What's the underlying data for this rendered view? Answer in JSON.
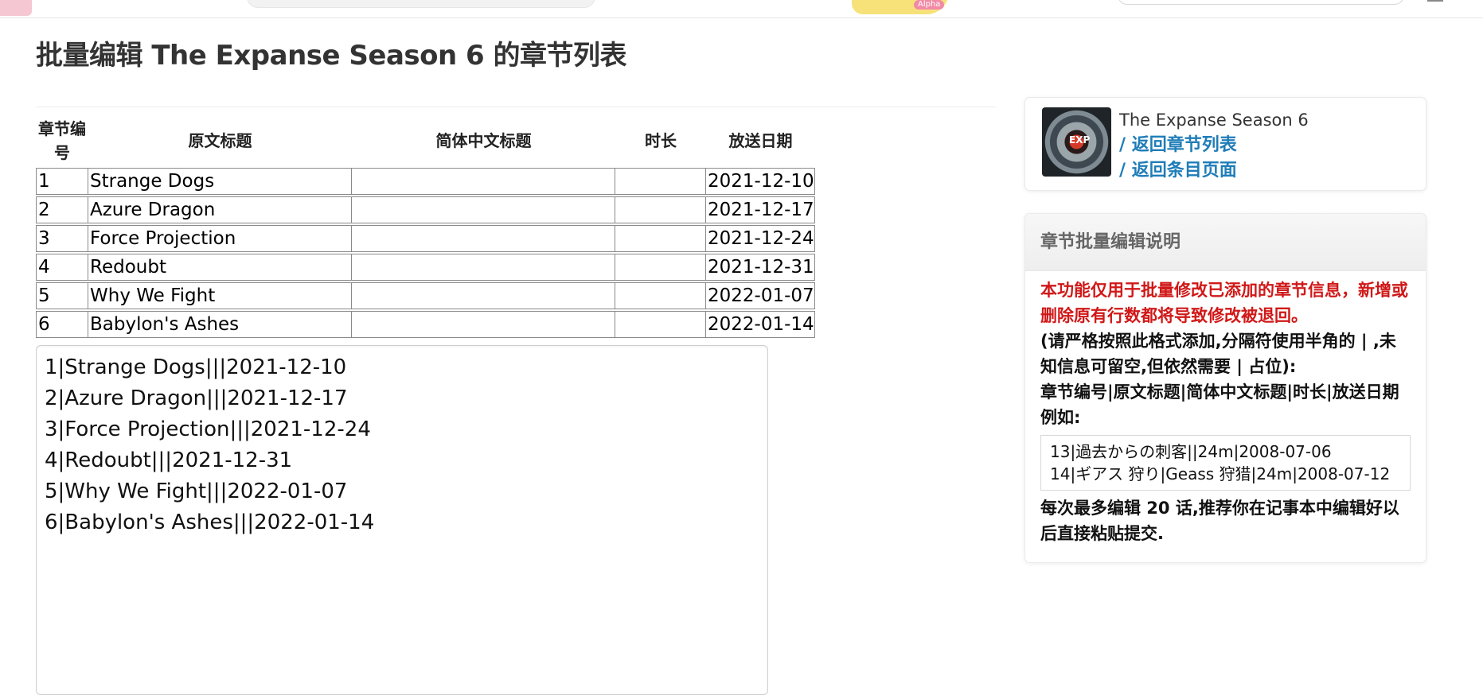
{
  "page": {
    "title": "批量编辑 The Expanse Season 6 的章节列表"
  },
  "topbar": {
    "banner_text": "Alpha"
  },
  "table": {
    "headers": [
      "章节编号",
      "原文标题",
      "简体中文标题",
      "时长",
      "放送日期"
    ],
    "rows": [
      {
        "num": "1",
        "title": "Strange Dogs",
        "title_cn": "",
        "duration": "",
        "airdate": "2021-12-10"
      },
      {
        "num": "2",
        "title": "Azure Dragon",
        "title_cn": "",
        "duration": "",
        "airdate": "2021-12-17"
      },
      {
        "num": "3",
        "title": "Force Projection",
        "title_cn": "",
        "duration": "",
        "airdate": "2021-12-24"
      },
      {
        "num": "4",
        "title": "Redoubt",
        "title_cn": "",
        "duration": "",
        "airdate": "2021-12-31"
      },
      {
        "num": "5",
        "title": "Why We Fight",
        "title_cn": "",
        "duration": "",
        "airdate": "2022-01-07"
      },
      {
        "num": "6",
        "title": "Babylon's Ashes",
        "title_cn": "",
        "duration": "",
        "airdate": "2022-01-14"
      }
    ]
  },
  "editor": {
    "value": "1|Strange Dogs|||2021-12-10\n2|Azure Dragon|||2021-12-17\n3|Force Projection|||2021-12-24\n4|Redoubt|||2021-12-31\n5|Why We Fight|||2022-01-07\n6|Babylon's Ashes|||2022-01-14"
  },
  "sidebar": {
    "subject": {
      "name": "The Expanse Season 6",
      "link_episodes": "/ 返回章节列表",
      "link_subject": "/ 返回条目页面"
    },
    "help": {
      "title": "章节批量编辑说明",
      "warning": "本功能仅用于批量修改已添加的章节信息，新增或删除原有行数都将导致修改被退回。",
      "format_note": "(请严格按照此格式添加,分隔符使用半角的 | ,未知信息可留空,但依然需要 | 占位):",
      "format": "章节编号|原文标题|简体中文标题|时长|放送日期",
      "example_label": "例如:",
      "example": "13|過去からの刺客||24m|2008-07-06\n14|ギアス 狩り|Geass 狩猎|24m|2008-07-12",
      "footer": "每次最多编辑 20 话,推荐你在记事本中编辑好以后直接粘贴提交."
    }
  }
}
